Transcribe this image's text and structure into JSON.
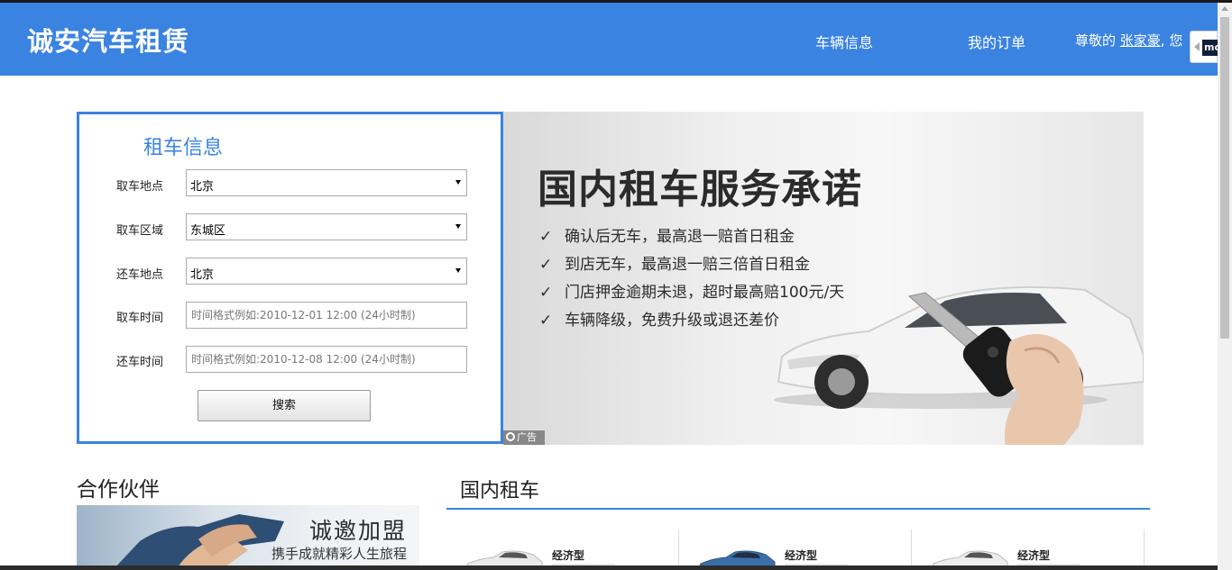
{
  "header": {
    "brand": "诚安汽车租赁",
    "nav": [
      {
        "label": "车辆信息"
      },
      {
        "label": "我的订单"
      }
    ],
    "greeting_prefix": "尊敬的 ",
    "username": "张家豪",
    "greeting_suffix": ", 您",
    "accent_color": "#3a83e1"
  },
  "side_widget": {
    "icon": "mo-extension-icon",
    "text": "mo"
  },
  "rental_form": {
    "title": "租车信息",
    "fields": [
      {
        "label": "取车地点",
        "type": "select",
        "value": "北京"
      },
      {
        "label": "取车区域",
        "type": "select",
        "value": "东城区"
      },
      {
        "label": "还车地点",
        "type": "select",
        "value": "北京"
      },
      {
        "label": "取车时间",
        "type": "input",
        "value": "",
        "placeholder": "时间格式例如:2010-12-01 12:00 (24小时制)"
      },
      {
        "label": "还车时间",
        "type": "input",
        "value": "",
        "placeholder": "时间格式例如:2010-12-08 12:00 (24小时制)"
      }
    ],
    "search_label": "搜索"
  },
  "banner": {
    "title": "国内租车服务承诺",
    "promises": [
      "确认后无车，最高退一赔首日租金",
      "到店无车，最高退一赔三倍首日租金",
      "门店押金逾期未退，超时最高赔100元/天",
      "车辆降级，免费升级或退还差价"
    ],
    "ad_label": "广告"
  },
  "partners": {
    "heading": "合作伙伴",
    "banner_title": "诚邀加盟",
    "banner_subtitle": "携手成就精彩人生旅程"
  },
  "domestic": {
    "heading": "国内租车",
    "cards": [
      {
        "class": "经济型"
      },
      {
        "class": "经济型"
      },
      {
        "class": "经济型"
      }
    ]
  }
}
